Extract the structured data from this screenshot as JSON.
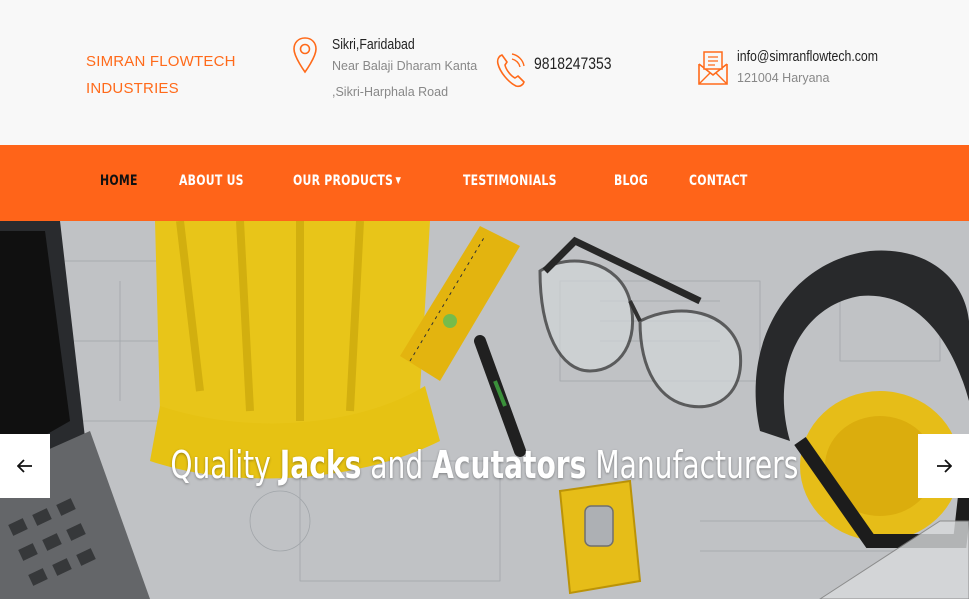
{
  "brand": {
    "line1": "SIMRAN FLOWTECH",
    "line2": "INDUSTRIES"
  },
  "address": {
    "title": "Sikri,Faridabad",
    "line1": "Near Balaji Dharam Kanta",
    "line2": ",Sikri-Harphala Road",
    "icon": "location-pin-icon"
  },
  "phone": {
    "number": "9818247353",
    "icon": "phone-icon"
  },
  "email": {
    "address": "info@simranflowtech.com",
    "line": "121004 Haryana",
    "icon": "mail-icon"
  },
  "nav": {
    "items": [
      {
        "label": "HOME",
        "active": true
      },
      {
        "label": "ABOUT US"
      },
      {
        "label": "OUR PRODUCTS",
        "dropdown": true
      },
      {
        "label": "TESTIMONIALS"
      },
      {
        "label": "BLOG"
      },
      {
        "label": "CONTACT"
      }
    ]
  },
  "hero": {
    "caption": {
      "w1": "Quality",
      "w2": "Jacks",
      "w3": "and",
      "w4": "Acutators",
      "w5": "Manufacturers"
    },
    "prev_icon": "arrow-left-icon",
    "next_icon": "arrow-right-icon"
  },
  "colors": {
    "accent": "#ff6419",
    "brand": "#ff6a1a"
  }
}
